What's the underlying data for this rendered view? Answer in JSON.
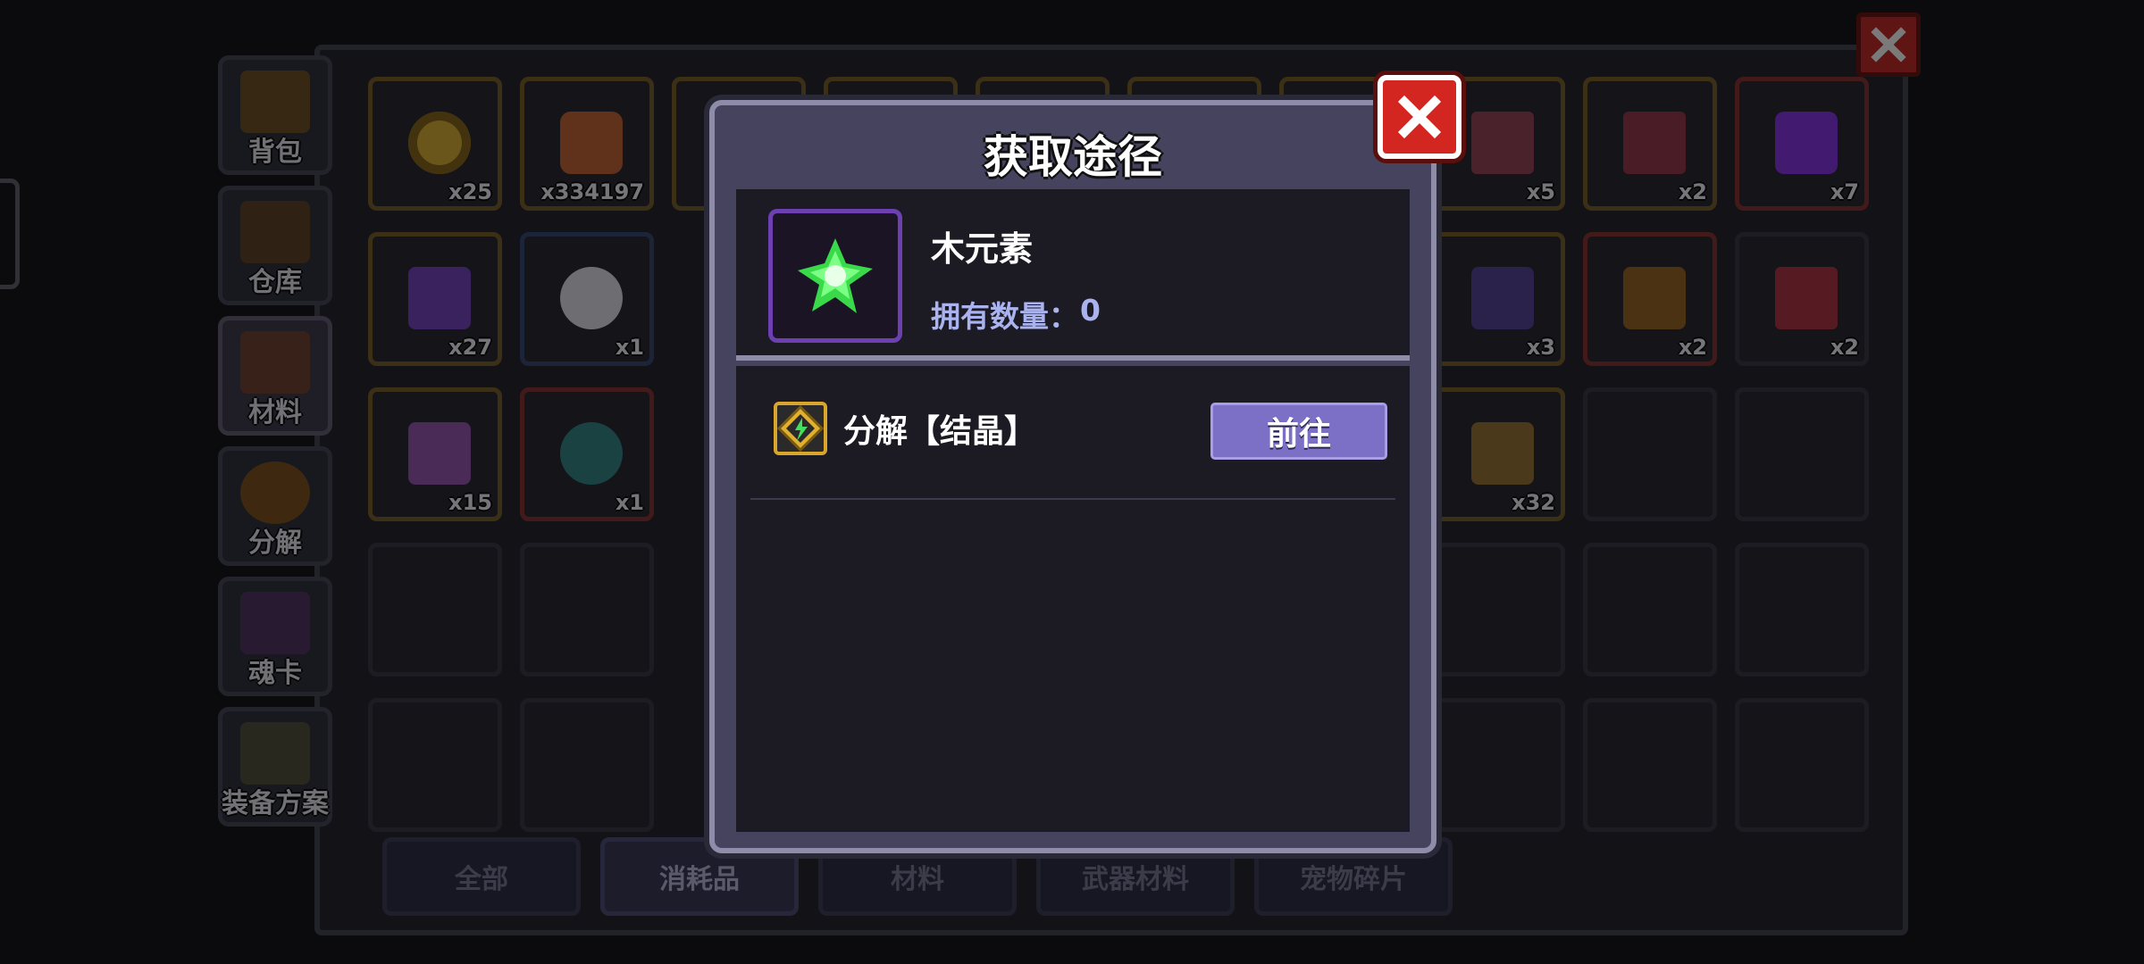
{
  "background": {
    "side_tabs": [
      {
        "label": "背包",
        "active": false
      },
      {
        "label": "仓库",
        "active": false
      },
      {
        "label": "材料",
        "active": true
      },
      {
        "label": "分解",
        "active": false
      },
      {
        "label": "魂卡",
        "active": false
      },
      {
        "label": "装备方案",
        "active": false
      }
    ],
    "slot_counts": {
      "r1c1": "x25",
      "r1c2": "x334197",
      "r1c9": "x5",
      "r1c10": "x2",
      "r1c11": "x7",
      "r2c1": "x27",
      "r2c2": "x1",
      "r2c9": "x3",
      "r2c10": "x2",
      "r2c11": "x2",
      "r3c1": "x15",
      "r3c2": "x1",
      "r3c9": "x32"
    },
    "bottom_tabs": [
      {
        "label": "全部",
        "active": false
      },
      {
        "label": "消耗品",
        "active": true
      },
      {
        "label": "材料",
        "active": false
      },
      {
        "label": "武器材料",
        "active": false
      },
      {
        "label": "宠物碎片",
        "active": false
      }
    ]
  },
  "modal": {
    "title": "获取途径",
    "item": {
      "name": "木元素",
      "count_label": "拥有数量：",
      "count_value": "0",
      "icon": "green-wood-crystal-icon"
    },
    "sources": [
      {
        "label": "分解【结晶】",
        "button": "前往",
        "icon": "decompose-crystal-icon"
      }
    ]
  },
  "colors": {
    "accent_purple": "#7c70c6",
    "close_red": "#d42620",
    "item_green": "#39d94a",
    "count_blue": "#aab3ee"
  }
}
